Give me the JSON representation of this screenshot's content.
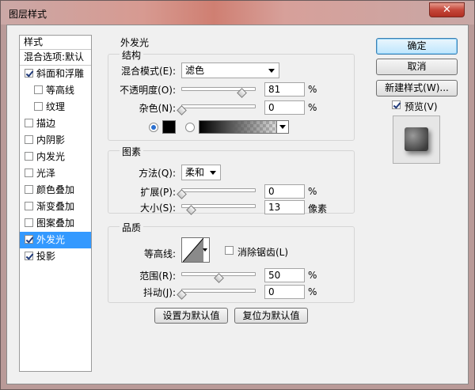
{
  "window": {
    "title": "图层样式",
    "close_glyph": "✕"
  },
  "left_list": {
    "header": "样式",
    "blend": "混合选项:默认",
    "items": [
      {
        "label": "斜面和浮雕",
        "checked": true,
        "sub": false
      },
      {
        "label": "等高线",
        "checked": false,
        "sub": true
      },
      {
        "label": "纹理",
        "checked": false,
        "sub": true
      },
      {
        "label": "描边",
        "checked": false,
        "sub": false
      },
      {
        "label": "内阴影",
        "checked": false,
        "sub": false
      },
      {
        "label": "内发光",
        "checked": false,
        "sub": false
      },
      {
        "label": "光泽",
        "checked": false,
        "sub": false
      },
      {
        "label": "颜色叠加",
        "checked": false,
        "sub": false
      },
      {
        "label": "渐变叠加",
        "checked": false,
        "sub": false
      },
      {
        "label": "图案叠加",
        "checked": false,
        "sub": false
      },
      {
        "label": "外发光",
        "checked": true,
        "sub": false,
        "selected": true
      },
      {
        "label": "投影",
        "checked": true,
        "sub": false
      }
    ]
  },
  "outer_glow": {
    "title": "外发光",
    "structure": {
      "title": "结构",
      "blend_mode_label": "混合模式(E):",
      "blend_mode_value": "滤色",
      "opacity_label": "不透明度(O):",
      "opacity_value": "81",
      "opacity_unit": "%",
      "opacity_level": 81,
      "noise_label": "杂色(N):",
      "noise_value": "0",
      "noise_unit": "%",
      "noise_level": 0,
      "glow_color": "#000000"
    },
    "elements": {
      "title": "图素",
      "technique_label": "方法(Q):",
      "technique_value": "柔和",
      "spread_label": "扩展(P):",
      "spread_value": "0",
      "spread_unit": "%",
      "spread_level": 0,
      "size_label": "大小(S):",
      "size_value": "13",
      "size_unit": "像素",
      "size_level": 5.2
    },
    "quality": {
      "title": "品质",
      "contour_label": "等高线:",
      "antialias_label": "消除锯齿(L)",
      "antialias_checked": false,
      "range_label": "范围(R):",
      "range_value": "50",
      "range_unit": "%",
      "range_level": 50,
      "jitter_label": "抖动(J):",
      "jitter_value": "0",
      "jitter_unit": "%",
      "jitter_level": 0
    },
    "make_default": "设置为默认值",
    "reset_default": "复位为默认值"
  },
  "right": {
    "ok": "确定",
    "cancel": "取消",
    "new_style": "新建样式(W)...",
    "preview_label": "预览(V)",
    "preview_checked": true
  }
}
